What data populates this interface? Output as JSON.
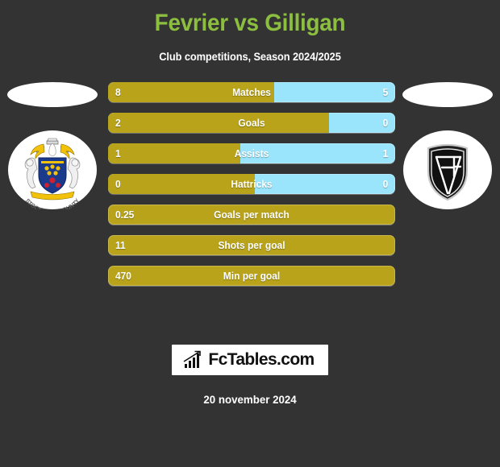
{
  "header": {
    "title": "Fevrier vs Gilligan",
    "subtitle": "Club competitions, Season 2024/2025"
  },
  "teams": {
    "home": {
      "badge_name": "stockport-county-crest",
      "badge_motto": "STOCKPORT COUNTY"
    },
    "away": {
      "badge_name": "af-shield-crest",
      "badge_monogram": "AF"
    }
  },
  "colors": {
    "background": "#333333",
    "title_green": "#8cbf3f",
    "home_gold": "#b8a31b",
    "away_blue": "#9ae5fb",
    "text_white": "#ffffff"
  },
  "chart_data": {
    "type": "bar",
    "title": "Fevrier vs Gilligan",
    "subtitle": "Club competitions, Season 2024/2025",
    "orientation": "horizontal-diverging",
    "categories": [
      "Matches",
      "Goals",
      "Assists",
      "Hattricks",
      "Goals per match",
      "Shots per goal",
      "Min per goal"
    ],
    "series": [
      {
        "name": "Fevrier",
        "color": "#b8a31b",
        "values": [
          "8",
          "2",
          "1",
          "0",
          "0.25",
          "11",
          "470"
        ]
      },
      {
        "name": "Gilligan",
        "color": "#9ae5fb",
        "values": [
          "5",
          "0",
          "1",
          "0",
          null,
          null,
          null
        ]
      }
    ],
    "legend": "none",
    "grid": false
  },
  "stats": [
    {
      "label": "Matches",
      "left": "8",
      "right": "5",
      "fill_pct": 58,
      "split": true
    },
    {
      "label": "Goals",
      "left": "2",
      "right": "0",
      "fill_pct": 77,
      "split": true
    },
    {
      "label": "Assists",
      "left": "1",
      "right": "1",
      "fill_pct": 46,
      "split": true
    },
    {
      "label": "Hattricks",
      "left": "0",
      "right": "0",
      "fill_pct": 51,
      "split": true
    },
    {
      "label": "Goals per match",
      "left": "0.25",
      "right": "",
      "fill_pct": 100,
      "split": false
    },
    {
      "label": "Shots per goal",
      "left": "11",
      "right": "",
      "fill_pct": 100,
      "split": false
    },
    {
      "label": "Min per goal",
      "left": "470",
      "right": "",
      "fill_pct": 100,
      "split": false
    }
  ],
  "footer": {
    "logo_icon": "bar-chart-trend-icon",
    "logo_text": "FcTables.com",
    "date": "20 november 2024"
  }
}
